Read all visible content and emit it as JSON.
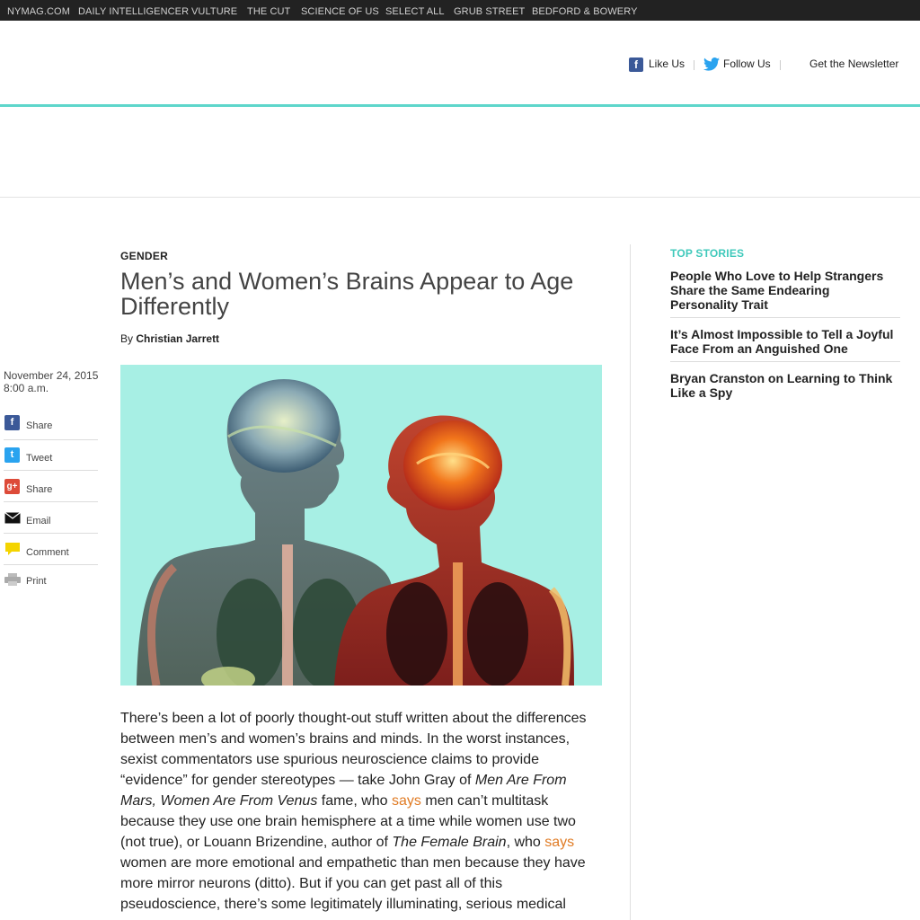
{
  "topnav": [
    "NYMAG.COM",
    "DAILY INTELLIGENCER",
    "VULTURE",
    "THE CUT",
    "SCIENCE OF US",
    "SELECT ALL",
    "GRUB STREET",
    "BEDFORD & BOWERY"
  ],
  "social": {
    "like": "Like Us",
    "follow": "Follow Us",
    "newsletter": "Get the Newsletter"
  },
  "article": {
    "rubric": "GENDER",
    "headline": "Men’s and Women’s Brains Appear to Age Differently",
    "by": "By",
    "author": "Christian Jarrett",
    "date": "November 24, 2015",
    "time": "8:00 a.m.",
    "body": {
      "p1": "There’s been a lot of poorly thought-out stuff written about the differences between men’s and women’s brains and minds. In the worst instances, sexist commentators use spurious neuroscience claims to provide “evidence” for gender stereotypes — take John Gray of ",
      "book1": "Men Are From Mars, Women Are From Venus",
      "p2": " fame, who ",
      "link1": "says",
      "p3": " men can’t multitask because they use one brain hemisphere at a time while women use two (not true), or Louann Brizendine, author of ",
      "book2": "The Female Brain",
      "p4": ", who ",
      "link2": "says",
      "p5": " women are more emotional and empathetic than men because they have more mirror neurons (ditto). But if you can get past all of this pseudoscience, there’s some legitimately illuminating, serious medical"
    }
  },
  "share": [
    {
      "label": "Share",
      "icon": "facebook-icon",
      "color": "#3b5998"
    },
    {
      "label": "Tweet",
      "icon": "twitter-icon",
      "color": "#2aa3ef"
    },
    {
      "label": "Share",
      "icon": "google-plus-icon",
      "color": "#dd4b39"
    },
    {
      "label": "Email",
      "icon": "email-icon",
      "color": "#111111"
    },
    {
      "label": "Comment",
      "icon": "comment-icon",
      "color": "#f4d400"
    },
    {
      "label": "Print",
      "icon": "print-icon",
      "color": "#aaaaaa"
    }
  ],
  "top_stories": {
    "heading": "TOP STORIES",
    "items": [
      "People Who Love to Help Strangers Share the Same Endearing Personality Trait",
      "It’s Almost Impossible to Tell a Joyful Face From an Anguished One",
      "Bryan Cranston on Learning to Think Like a Spy"
    ]
  },
  "colors": {
    "accent_teal": "#5ed6cb",
    "link_orange": "#e07b24",
    "hero_bg": "#a7efe4"
  }
}
